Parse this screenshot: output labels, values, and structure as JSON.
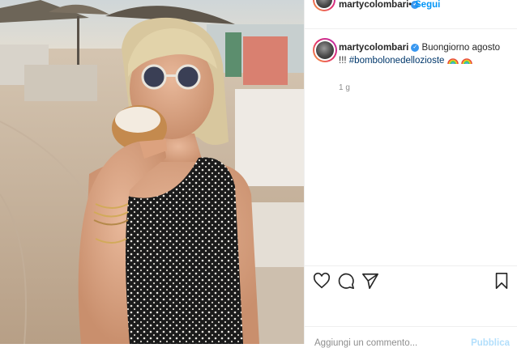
{
  "header": {
    "username": "marty​colombari",
    "separator": "•",
    "follow_label": "Segui"
  },
  "caption": {
    "username": "marty​colombari",
    "text": "Buongiorno agosto !!! ",
    "hashtag": "#bombolonedellozioste",
    "emoji": "rainbow"
  },
  "timestamp": "1 g",
  "actions": {
    "like_icon": "heart-icon",
    "comment_icon": "comment-icon",
    "share_icon": "share-icon",
    "save_icon": "bookmark-icon"
  },
  "comment_box": {
    "placeholder": "Aggiungi un commento...",
    "publish_label": "Pubblica"
  },
  "colors": {
    "link_blue": "#0095f6",
    "verified_blue": "#3897f0",
    "hashtag": "#00376b",
    "muted": "#8e8e8e"
  }
}
